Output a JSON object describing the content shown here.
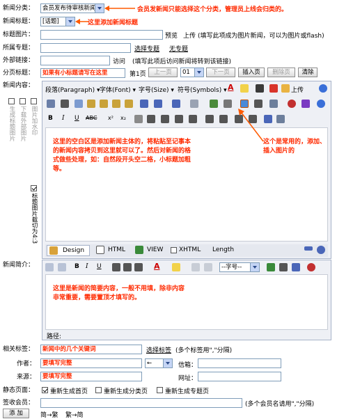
{
  "category": {
    "label": "新闻分类：",
    "value": "会员发布待审核新闻",
    "note": "会员发新闻只能选择这个分类，管理员上线会归类的。"
  },
  "title": {
    "label": "新闻标题：",
    "tag": "[话题]",
    "note": "这里添加新闻标题"
  },
  "image": {
    "label": "标题图片：",
    "preview": "预览",
    "upload": "上传",
    "hint": "(填写此项成为图片新闻，可以为图片或flash)"
  },
  "topic": {
    "label": "所属专题：",
    "select": "选择专题",
    "none": "无专题"
  },
  "outer": {
    "label": "外部链接：",
    "visit": "访问",
    "hint": "(填写此项后访问新闻将转到该链接)"
  },
  "paging": {
    "label": "分页标题：",
    "note": "如果有小标题请写在这里",
    "page": "第1页",
    "prev": "上一页",
    "page_sel": "01",
    "next": "下一页",
    "insert": "插入页",
    "delete": "删除页",
    "clear": "清除"
  },
  "content": {
    "label": "新闻内容：",
    "tb1": {
      "para": "段落(Paragraph)",
      "font": "字体(Font)",
      "size": "字号(Size)",
      "symbol": "符号(Symbols)",
      "upload": "上传"
    },
    "left_opts": {
      "gen": "生成标题图片",
      "remote": "下载外部图片",
      "wm": "图片加水印",
      "crop": "标题图片截切为4:3"
    },
    "body_note": "这里的空白区是添加新闻主体的，将粘贴至记事本的新闻内容拷贝到这里就可以了。然后对新闻的格式做些处理，如：自然段开头空二格，小标题加粗等。",
    "icon_note": "这个是常用的，添加、插入图片的",
    "tabs": {
      "design": "Design",
      "html": "HTML",
      "view": "VIEW",
      "xhtml": "XHTML",
      "length": "Length"
    }
  },
  "summary": {
    "label": "新闻简介：",
    "size_sel": "--字号--",
    "note": "这里是新闻的简要内容，一般不用填，除非内容非常重要，需要置顶才填写的。",
    "path": "路径:"
  },
  "tags": {
    "label": "相关标签：",
    "note": "新闻中的几个关键词",
    "select": "选择标签",
    "hint": "(多个标签用\",\"分隔)"
  },
  "author": {
    "label": "作者：",
    "note": "要填写完整",
    "arrow": "←",
    "mail": "信箱："
  },
  "source": {
    "label": "来源：",
    "note": "要填写完整",
    "url": "网址："
  },
  "static": {
    "label": "静态页面：",
    "opt1": "重新生成首页",
    "opt2": "重新生成分类页",
    "opt3": "重新生成专题页"
  },
  "readers": {
    "label": "签收会员：",
    "hint": "(多个会员名请用\",\"分隔)"
  },
  "bottom": {
    "add": "添 加",
    "conv1": "简→繁",
    "conv2": "繁→简"
  }
}
